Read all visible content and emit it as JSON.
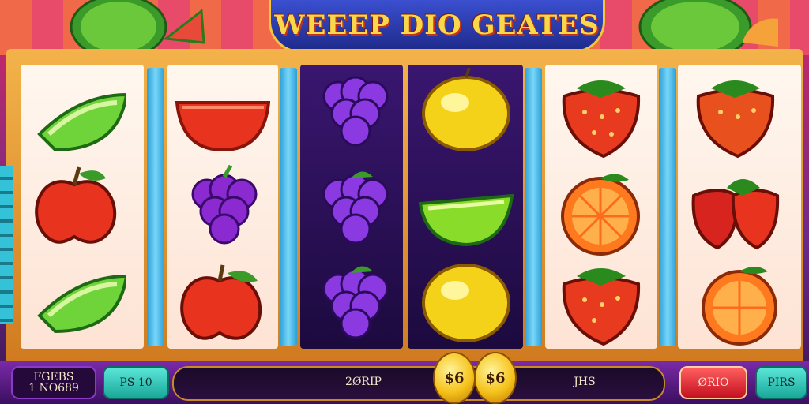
{
  "game": {
    "title": "WEEEP DIO GEATES"
  },
  "reels": [
    {
      "id": 1,
      "symbols": [
        "lime-slice",
        "apple",
        "lime-slice"
      ]
    },
    {
      "id": 2,
      "symbols": [
        "watermelon-slice",
        "grapes",
        "apple"
      ]
    },
    {
      "id": 3,
      "symbols": [
        "grapes",
        "grapes",
        "grapes"
      ]
    },
    {
      "id": 4,
      "symbols": [
        "lemon",
        "lime-slice",
        "lemon"
      ]
    },
    {
      "id": 5,
      "symbols": [
        "strawberry",
        "orange-half",
        "strawberry"
      ]
    },
    {
      "id": 6,
      "symbols": [
        "strawberry",
        "strawberry",
        "orange-half"
      ]
    }
  ],
  "bottom_bar": {
    "balance_label": "FGEBS",
    "balance_value": "1 NO689",
    "bet_button": "PS 10",
    "left_readout": "2ØRIP",
    "coin_left": "$6",
    "coin_right": "$6",
    "right_readout": "JHS",
    "spin_button": "ØRIO",
    "auto_button": "PIRS"
  },
  "colors": {
    "accent_gold": "#f5c53a",
    "title_blue": "#3b4fd0",
    "divider_cyan": "#2aa0d8",
    "panel_purple": "#24093a"
  }
}
